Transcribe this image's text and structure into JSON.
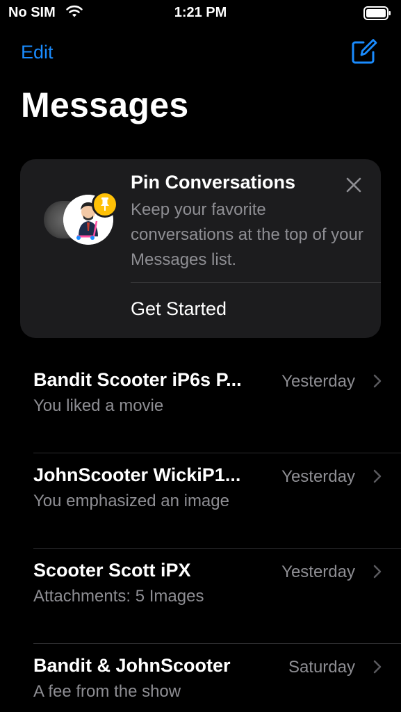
{
  "status": {
    "carrier": "No SIM",
    "time": "1:21 PM"
  },
  "nav": {
    "edit_label": "Edit"
  },
  "page": {
    "title": "Messages"
  },
  "pin_card": {
    "title": "Pin Conversations",
    "description": "Keep your favorite conversations at the top of your Messages list.",
    "action_label": "Get Started"
  },
  "conversations": [
    {
      "name": "Bandit Scooter iP6s P...",
      "date": "Yesterday",
      "preview": "You liked a movie"
    },
    {
      "name": "JohnScooter WickiP1...",
      "date": "Yesterday",
      "preview": "You emphasized an image"
    },
    {
      "name": "Scooter Scott iPX",
      "date": "Yesterday",
      "preview": "Attachments: 5 Images"
    },
    {
      "name": "Bandit & JohnScooter",
      "date": "Saturday",
      "preview": "A fee from the show"
    }
  ],
  "colors": {
    "accent": "#1a8cff",
    "pin_badge": "#ffc107",
    "card_bg": "#1c1c1e",
    "secondary_text": "#8e8e93"
  }
}
